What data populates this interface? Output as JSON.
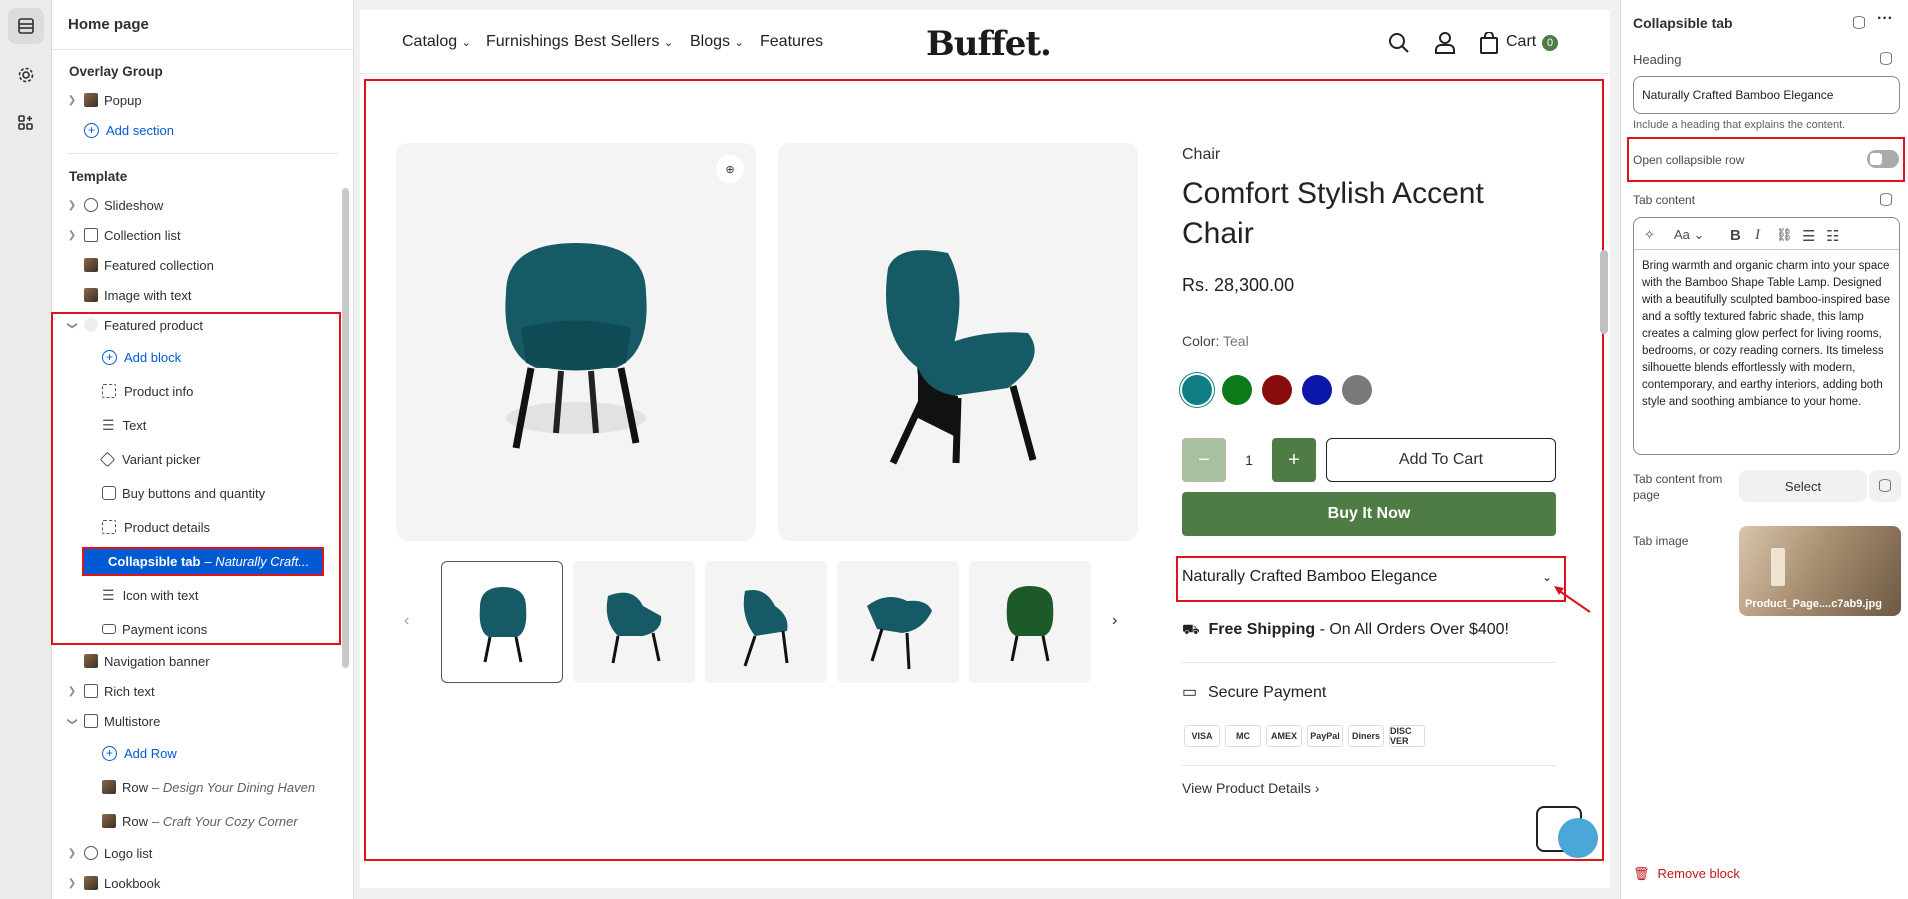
{
  "left_sidebar": {
    "title": "Home page",
    "overlay_group": {
      "title": "Overlay Group",
      "popup": "Popup",
      "add_section": "Add section"
    },
    "template": {
      "title": "Template",
      "items": {
        "slideshow": "Slideshow",
        "collection_list": "Collection list",
        "featured_collection": "Featured collection",
        "image_with_text": "Image with text",
        "featured_product": "Featured product",
        "navigation_banner": "Navigation banner",
        "rich_text": "Rich text",
        "multistore": "Multistore",
        "logo_list": "Logo list",
        "lookbook": "Lookbook"
      },
      "featured_product_blocks": {
        "add_block": "Add block",
        "product_info": "Product info",
        "text": "Text",
        "variant_picker": "Variant picker",
        "buy_buttons": "Buy buttons and quantity",
        "product_details": "Product details",
        "collapsible_tab": "Collapsible tab",
        "collapsible_tab_sub": "– Naturally Craft...",
        "icon_with_text": "Icon with text",
        "payment_icons": "Payment icons"
      },
      "multistore_rows": {
        "add_row": "Add Row",
        "row1": "Row",
        "row1_sub": "– Design Your Dining Haven",
        "row2": "Row",
        "row2_sub": "– Craft Your Cozy Corner"
      }
    }
  },
  "store": {
    "nav": {
      "catalog": "Catalog",
      "furnishings": "Furnishings",
      "best_sellers": "Best Sellers",
      "blogs": "Blogs",
      "features": "Features",
      "logo": "Buffet.",
      "cart": "Cart",
      "cart_count": "0"
    },
    "product": {
      "vendor": "Chair",
      "title": "Comfort Stylish Accent Chair",
      "price": "Rs. 28,300.00",
      "color_label": "Color:",
      "color_value": "Teal",
      "swatches": [
        "#0f7f85",
        "#0b7a18",
        "#8a0b0b",
        "#0a17a8",
        "#7a7a7a"
      ],
      "quantity": "1",
      "minus": "−",
      "plus": "+",
      "add_to_cart": "Add To Cart",
      "buy_now": "Buy It Now",
      "collapsible_heading": "Naturally Crafted Bamboo Elegance",
      "shipping_bold": "Free Shipping",
      "shipping_rest": " - On All Orders Over $400!",
      "secure_payment": "Secure Payment",
      "payments": [
        "VISA",
        "MC",
        "AMEX",
        "PayPal",
        "Diners",
        "DISC VER"
      ],
      "view_details": "View Product Details"
    }
  },
  "right_panel": {
    "title": "Collapsible tab",
    "heading_label": "Heading",
    "heading_value": "Naturally Crafted Bamboo Elegance",
    "heading_help": "Include a heading that explains the content.",
    "open_row_label": "Open collapsible row",
    "open_row_on": false,
    "tab_content_label": "Tab content",
    "tab_content_text": "Bring warmth and organic charm into your space with the Bamboo Shape Table Lamp. Designed with a beautifully sculpted bamboo-inspired base and a softly textured fabric shade, this lamp creates a calming glow perfect for living rooms, bedrooms, or cozy reading corners. Its timeless silhouette blends effortlessly with modern, contemporary, and earthy interiors, adding both style and soothing ambiance to your home.",
    "tab_content_from_page_label": "Tab content from page",
    "select_label": "Select",
    "tab_image_label": "Tab image",
    "tab_image_filename": "Product_Page....c7ab9.jpg",
    "remove_block": "Remove block"
  },
  "colors": {
    "accent_blue": "#005bd3",
    "annotation_red": "#e0121b",
    "brand_green": "#4f7c44",
    "danger": "#c5141c"
  }
}
